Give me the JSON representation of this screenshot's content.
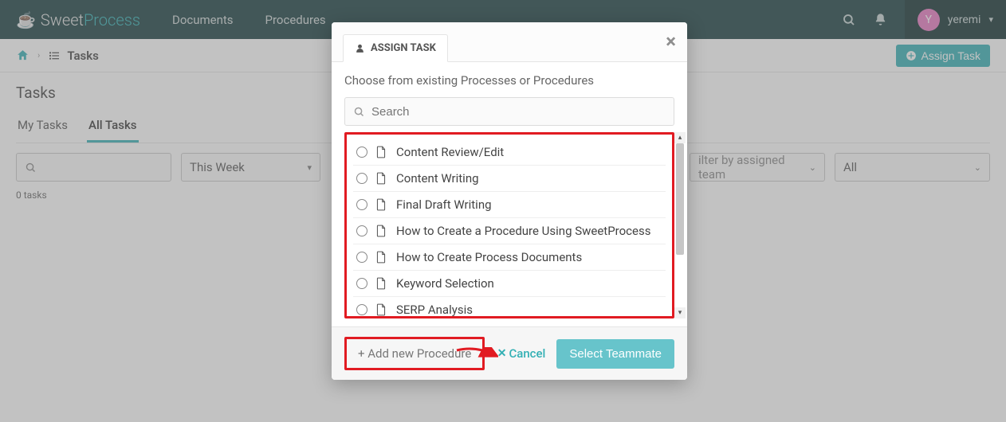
{
  "brand": {
    "part1": "Sweet",
    "part2": "Process"
  },
  "nav": {
    "documents": "Documents",
    "procedures": "Procedures"
  },
  "user": {
    "initial": "Y",
    "name": "yeremi"
  },
  "breadcrumb": {
    "current": "Tasks"
  },
  "buttons": {
    "assign_task": "Assign Task"
  },
  "page": {
    "title": "Tasks",
    "count": "0 tasks"
  },
  "tabs": {
    "my": "My Tasks",
    "all": "All Tasks"
  },
  "filters": {
    "week": "This Week",
    "team_placeholder": "ilter by assigned team",
    "all": "All"
  },
  "modal": {
    "tab_label": "ASSIGN TASK",
    "desc": "Choose from existing Processes or Procedures",
    "search_placeholder": "Search",
    "items": [
      "Content Review/Edit",
      "Content Writing",
      "Final Draft Writing",
      "How to Create a Procedure Using SweetProcess",
      "How to Create Process Documents",
      "Keyword Selection",
      "SERP Analysis"
    ],
    "add_new": "+ Add new Procedure",
    "cancel": "Cancel",
    "select": "Select Teammate"
  }
}
